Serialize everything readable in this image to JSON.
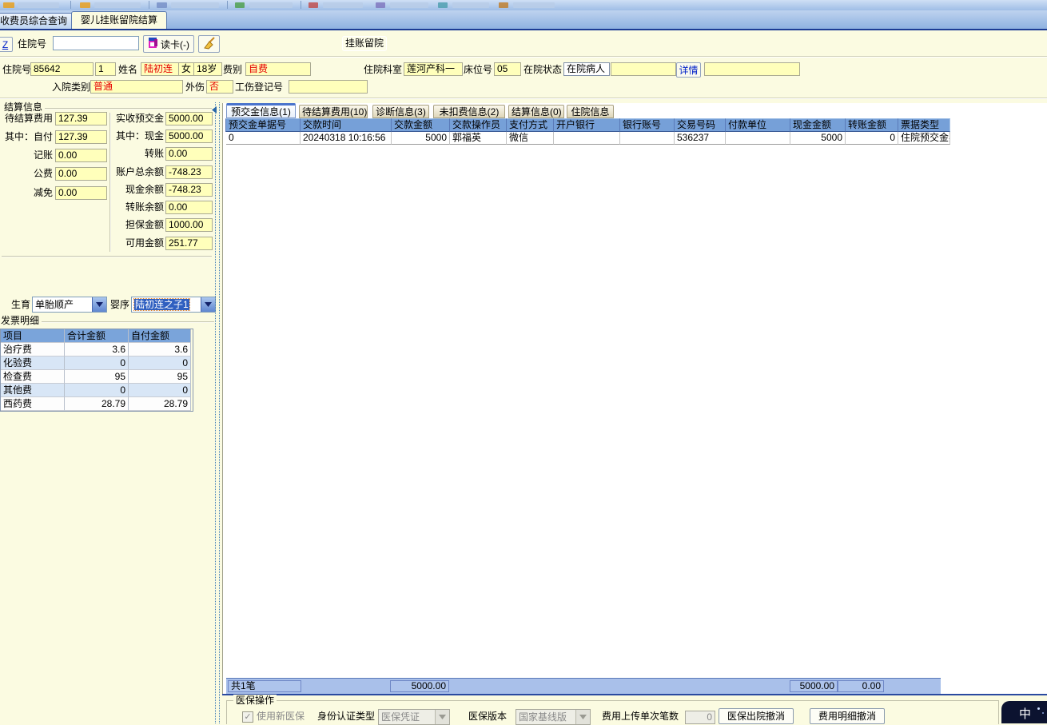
{
  "colors": {
    "background_cream": "#fbfbe1",
    "field_yellow": "#ffffbb",
    "red_value_text": "#e60000",
    "grid_header_blue": "#76a0d8",
    "summary_bar_blue": "#a9c0ea",
    "tabbar_blue": "#8fb2e0",
    "selection_blue": "#2f5fc0",
    "ime_navy": "#0c1330"
  },
  "window_tabs": [
    {
      "label": "收费员综合查询"
    },
    {
      "label": "婴儿挂账留院结算"
    }
  ],
  "search_row": {
    "z_button": "Z",
    "inpatient_no_label": "住院号",
    "inpatient_no_value": "",
    "read_card_button": "读卡(-)",
    "read_card_icon": "card-reader-icon",
    "clear_icon": "broom-icon",
    "mode_label": "挂账留院"
  },
  "patient": {
    "inpatient_no_label": "住院号",
    "inpatient_no": "85642",
    "admit_times": "1",
    "name_label": "姓名",
    "name": "陆初连",
    "gender": "女",
    "age": "18岁",
    "fee_type_label": "费别",
    "fee_type": "自费",
    "dept_label": "住院科室",
    "dept": "莲河产科一",
    "bed_label": "床位号",
    "bed": "05",
    "status_label": "在院状态",
    "status": "在院病人",
    "status_extra": "",
    "detail_button": "详情",
    "detail_extra": "",
    "admission_type_label": "入院类别",
    "admission_type": "普通",
    "injury_label": "外伤",
    "injury": "否",
    "injury_no_label": "工伤登记号",
    "injury_no": ""
  },
  "settlement": {
    "title": "结算信息",
    "left": [
      {
        "label": "待结算费用",
        "value": "127.39"
      },
      {
        "label": "其中：自付",
        "value": "127.39"
      },
      {
        "label": "记账",
        "value": "0.00"
      },
      {
        "label": "公费",
        "value": "0.00"
      },
      {
        "label": "减免",
        "value": "0.00"
      }
    ],
    "right": [
      {
        "label": "实收预交金",
        "value": "5000.00"
      },
      {
        "label": "其中：现金",
        "value": "5000.00"
      },
      {
        "label": "转账",
        "value": "0.00"
      },
      {
        "label": "账户总余额",
        "value": "-748.23"
      },
      {
        "label": "现金余额",
        "value": "-748.23"
      },
      {
        "label": "转账余额",
        "value": "0.00"
      },
      {
        "label": "担保金额",
        "value": "1000.00"
      },
      {
        "label": "可用金额",
        "value": "251.77"
      }
    ]
  },
  "birth_row": {
    "birth_label": "生育",
    "birth_value": "单胎顺产",
    "baby_label": "婴序",
    "baby_value": "陆初连之子1"
  },
  "invoice": {
    "title": "发票明细",
    "columns": [
      "项目",
      "合计金额",
      "自付金额"
    ],
    "rows": [
      {
        "name": "治疗费",
        "total": "3.6",
        "self": "3.6"
      },
      {
        "name": "化验费",
        "total": "0",
        "self": "0"
      },
      {
        "name": "检查费",
        "total": "95",
        "self": "95"
      },
      {
        "name": "其他费",
        "total": "0",
        "self": "0"
      },
      {
        "name": "西药费",
        "total": "28.79",
        "self": "28.79"
      }
    ]
  },
  "detail_tabs": [
    {
      "label": "预交金信息(1)"
    },
    {
      "label": "待结算费用(10)"
    },
    {
      "label": "诊断信息(3)"
    },
    {
      "label": "未扣费信息(2)"
    },
    {
      "label": "结算信息(0)"
    },
    {
      "label": "住院信息"
    }
  ],
  "grid": {
    "columns": [
      "预交金单据号",
      "交款时间",
      "交款金额",
      "交款操作员",
      "支付方式",
      "开户银行",
      "银行账号",
      "交易号码",
      "付款单位",
      "现金金额",
      "转账金额",
      "票据类型"
    ],
    "row": [
      "0",
      "20240318 10:16:56",
      "5000",
      "郭福英",
      "微信",
      "",
      "",
      "536237",
      "",
      "5000",
      "0",
      "住院预交金票据"
    ]
  },
  "summary": {
    "count": "共1笔",
    "amount": "5000.00",
    "cash": "5000.00",
    "transfer": "0.00"
  },
  "insurance": {
    "title": "医保操作",
    "use_new_label": "使用新医保",
    "auth_type_label": "身份认证类型",
    "auth_type_value": "医保凭证",
    "version_label": "医保版本",
    "version_value": "国家基线版",
    "batch_label": "费用上传单次笔数",
    "batch_value": "0",
    "discharge_cancel_button": "医保出院撤消",
    "detail_cancel_button": "费用明细撤消"
  },
  "ime": {
    "indicator": "中"
  }
}
